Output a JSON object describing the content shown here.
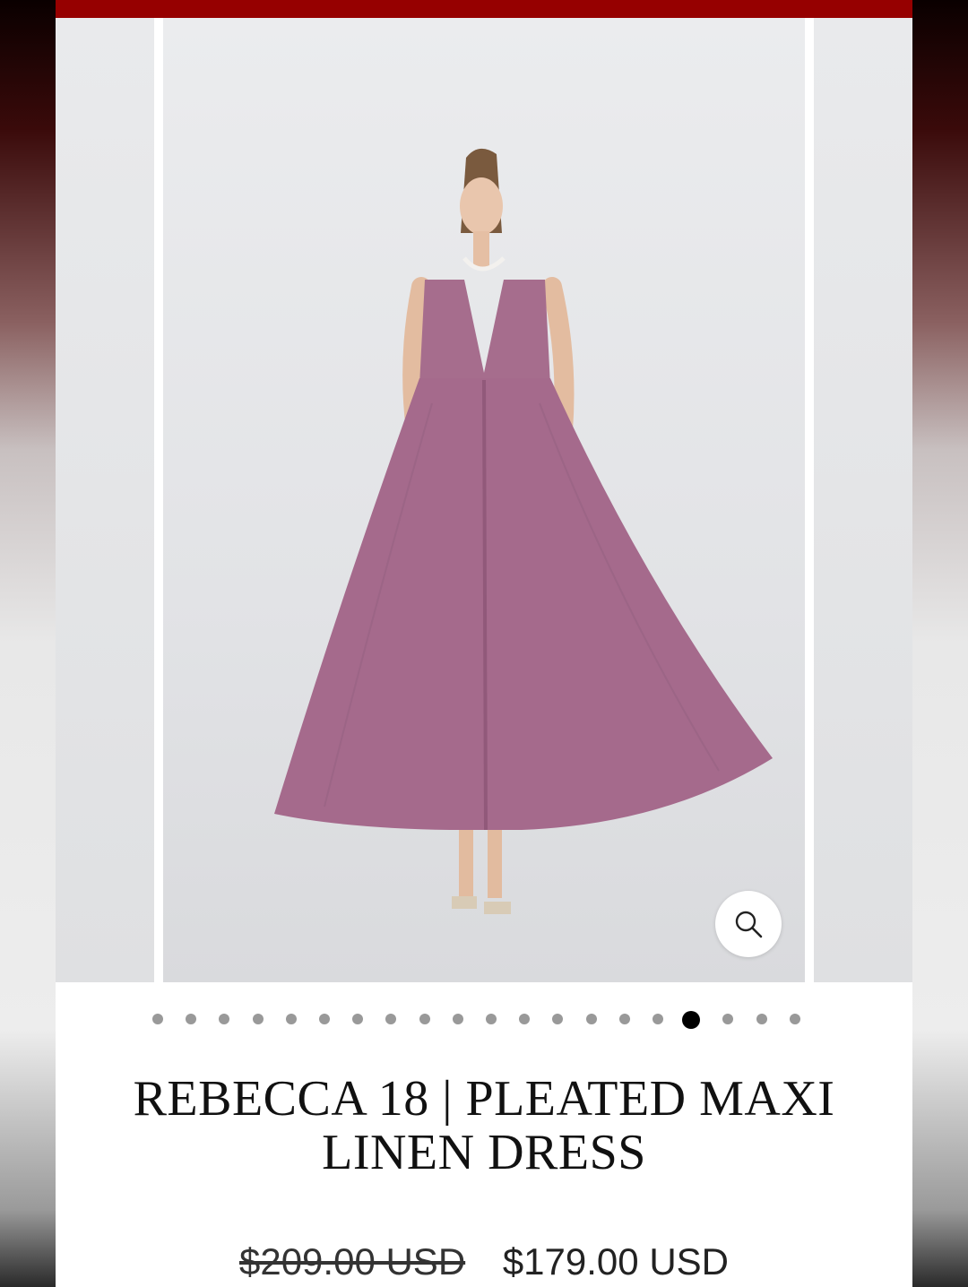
{
  "product": {
    "title_line1": "REBECCA 18 | PLEATED MAXI",
    "title_line2": "LINEN DRESS",
    "original_price": "$209.00 USD",
    "sale_price": "$179.00 USD"
  },
  "gallery": {
    "total_images": 20,
    "active_index": 16,
    "zoom_icon": "search-icon"
  },
  "colors": {
    "accent": "#960000",
    "dress": "#a56a8c"
  }
}
